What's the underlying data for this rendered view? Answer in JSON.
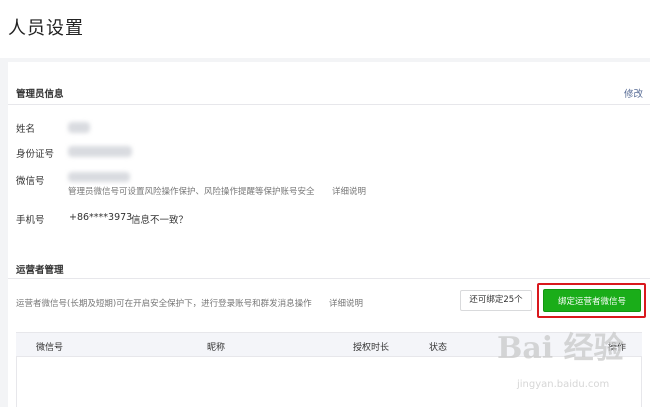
{
  "page": {
    "title": "人员设置"
  },
  "admin_section": {
    "title": "管理员信息",
    "edit_label": "修改",
    "name_label": "姓名",
    "id_label": "身份证号",
    "wechat_label": "微信号",
    "wechat_hint": "管理员微信号可设置风险操作保护、风险操作提醒等保护账号安全",
    "wechat_hint_link": "详细说明",
    "phone_label": "手机号",
    "phone_value": "+86****3973",
    "phone_link": "信息不一致？"
  },
  "operator_section": {
    "title": "运营者管理",
    "desc": "运营者微信号(长期及短期)可在开启安全保护下，进行登录账号和群发消息操作",
    "desc_link": "详细说明",
    "remaining": "还可绑定25个",
    "bind_button": "绑定运营者微信号",
    "table_headers": [
      "微信号",
      "昵称",
      "授权时长",
      "状态",
      "操作"
    ]
  },
  "watermark": {
    "main": "Bai 经验",
    "sub": "jingyan.baidu.com"
  },
  "colors": {
    "accent_green": "#1aad19",
    "link": "#576b95",
    "highlight_red": "#d9181d"
  }
}
